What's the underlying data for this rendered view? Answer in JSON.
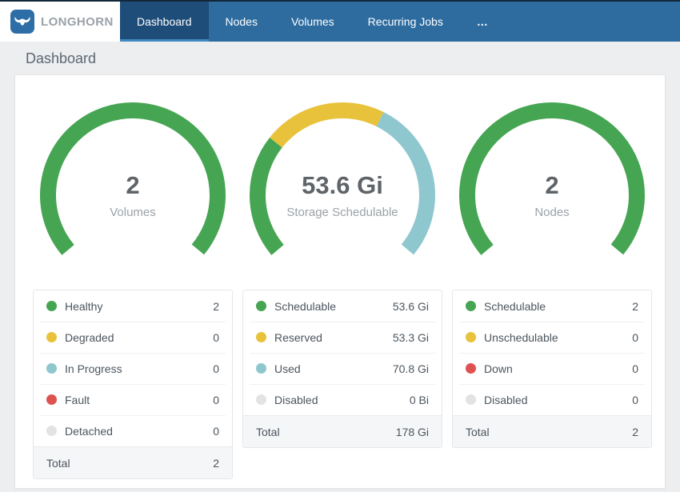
{
  "header": {
    "brand": "LONGHORN",
    "nav": [
      {
        "label": "Dashboard",
        "active": true
      },
      {
        "label": "Nodes",
        "active": false
      },
      {
        "label": "Volumes",
        "active": false
      },
      {
        "label": "Recurring Jobs",
        "active": false
      },
      {
        "label": "…",
        "active": false
      }
    ]
  },
  "page": {
    "title": "Dashboard"
  },
  "palette": {
    "green": "#46a553",
    "yellow": "#e9c23c",
    "teal": "#8fc7cf",
    "red": "#dd5350",
    "gray": "#e2e3e4"
  },
  "chart_data": [
    {
      "type": "gauge",
      "name": "volumes",
      "center_value": "2",
      "center_label": "Volumes",
      "sweep_deg": 260,
      "rows": [
        {
          "label": "Healthy",
          "color": "green",
          "value": 2,
          "display": "2"
        },
        {
          "label": "Degraded",
          "color": "yellow",
          "value": 0,
          "display": "0"
        },
        {
          "label": "In Progress",
          "color": "teal",
          "value": 0,
          "display": "0"
        },
        {
          "label": "Fault",
          "color": "red",
          "value": 0,
          "display": "0"
        },
        {
          "label": "Detached",
          "color": "gray",
          "value": 0,
          "display": "0"
        }
      ],
      "total": {
        "label": "Total",
        "display": "2"
      }
    },
    {
      "type": "gauge",
      "name": "storage-schedulable",
      "center_value": "53.6 Gi",
      "center_label": "Storage Schedulable",
      "sweep_deg": 260,
      "rows": [
        {
          "label": "Schedulable",
          "color": "green",
          "value": 53.6,
          "display": "53.6 Gi"
        },
        {
          "label": "Reserved",
          "color": "yellow",
          "value": 53.3,
          "display": "53.3 Gi"
        },
        {
          "label": "Used",
          "color": "teal",
          "value": 70.8,
          "display": "70.8 Gi"
        },
        {
          "label": "Disabled",
          "color": "gray",
          "value": 0,
          "display": "0 Bi"
        }
      ],
      "total": {
        "label": "Total",
        "display": "178 Gi"
      }
    },
    {
      "type": "gauge",
      "name": "nodes",
      "center_value": "2",
      "center_label": "Nodes",
      "sweep_deg": 260,
      "rows": [
        {
          "label": "Schedulable",
          "color": "green",
          "value": 2,
          "display": "2"
        },
        {
          "label": "Unschedulable",
          "color": "yellow",
          "value": 0,
          "display": "0"
        },
        {
          "label": "Down",
          "color": "red",
          "value": 0,
          "display": "0"
        },
        {
          "label": "Disabled",
          "color": "gray",
          "value": 0,
          "display": "0"
        }
      ],
      "total": {
        "label": "Total",
        "display": "2"
      }
    }
  ]
}
